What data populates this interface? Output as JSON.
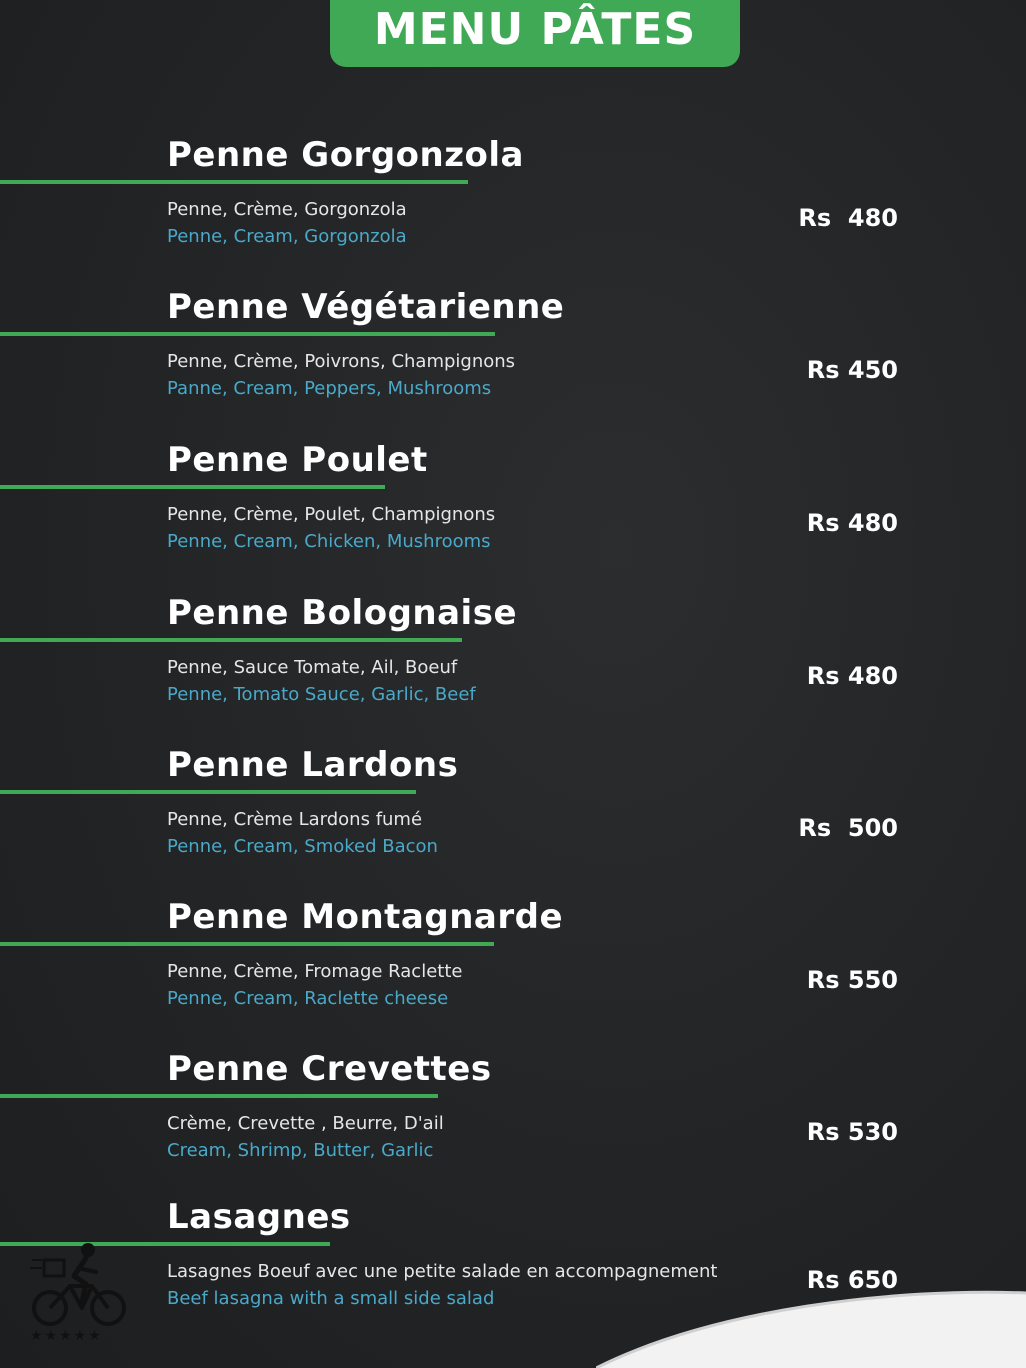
{
  "header": {
    "title": "MENU PÂTES"
  },
  "items": [
    {
      "name": "Penne Gorgonzola",
      "desc_fr": "Penne, Crème, Gorgonzola",
      "desc_en": "Penne, Cream, Gorgonzola",
      "price": "Rs  480"
    },
    {
      "name": "Penne Végétarienne",
      "desc_fr": "Penne, Crème, Poivrons, Champignons",
      "desc_en": "Panne, Cream, Peppers, Mushrooms",
      "price": "Rs 450"
    },
    {
      "name": "Penne Poulet",
      "desc_fr": "Penne, Crème, Poulet, Champignons",
      "desc_en": "Penne, Cream, Chicken, Mushrooms",
      "price": "Rs 480"
    },
    {
      "name": "Penne Bolognaise",
      "desc_fr": "Penne, Sauce Tomate, Ail, Boeuf",
      "desc_en": "Penne, Tomato Sauce, Garlic, Beef",
      "price": "Rs 480"
    },
    {
      "name": "Penne Lardons",
      "desc_fr": "Penne, Crème Lardons fumé",
      "desc_en": "Penne, Cream, Smoked Bacon",
      "price": "Rs  500"
    },
    {
      "name": "Penne Montagnarde",
      "desc_fr": "Penne, Crème, Fromage Raclette",
      "desc_en": "Penne, Cream, Raclette cheese",
      "price": "Rs 550"
    },
    {
      "name": "Penne Crevettes",
      "desc_fr": "Crème, Crevette , Beurre, D'ail",
      "desc_en": "Cream, Shrimp, Butter, Garlic",
      "price": "Rs 530"
    },
    {
      "name": "Lasagnes",
      "desc_fr": "Lasagnes Boeuf avec une petite salade en accompagnement",
      "desc_en": "Beef lasagna with a small side salad",
      "price": "Rs 650"
    }
  ],
  "logo": {
    "icon": "bicycle-rider-icon",
    "rating_stars": 5
  },
  "colors": {
    "accent": "#3fa955",
    "english_text": "#4aa9c9",
    "background": "#232527"
  }
}
